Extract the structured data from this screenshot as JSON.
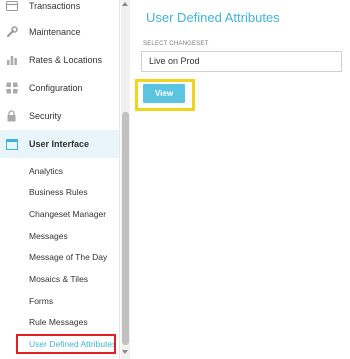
{
  "sidebar": {
    "items": [
      {
        "label": "Transactions",
        "icon": "card-icon"
      },
      {
        "label": "Maintenance",
        "icon": "wrench-icon"
      },
      {
        "label": "Rates & Locations",
        "icon": "bar-chart-icon"
      },
      {
        "label": "Configuration",
        "icon": "grid-icon"
      },
      {
        "label": "Security",
        "icon": "lock-icon"
      },
      {
        "label": "User Interface",
        "icon": "window-icon"
      }
    ],
    "sub_items": [
      "Analytics",
      "Business Rules",
      "Changeset Manager",
      "Messages",
      "Message of The Day",
      "Mosaics & Tiles",
      "Forms",
      "Rule Messages",
      "User Defined Attributes"
    ]
  },
  "main": {
    "title": "User Defined Attributes",
    "changeset_label": "SELECT CHANGESET",
    "changeset_value": "Live on Prod",
    "view_button": "View"
  },
  "colors": {
    "accent": "#3fb4d9",
    "button": "#5bc5e1",
    "active_bg": "#e8f5fb",
    "highlight_red": "#e21f26",
    "highlight_yellow": "#f1d41b"
  }
}
